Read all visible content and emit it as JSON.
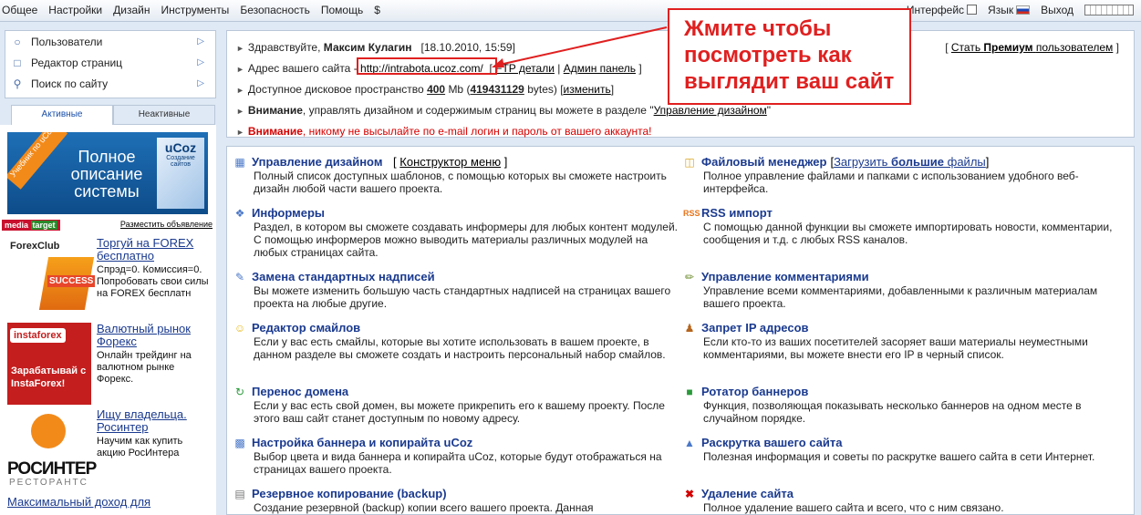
{
  "topbar": {
    "menu": [
      "Общее",
      "Настройки",
      "Дизайн",
      "Инструменты",
      "Безопасность",
      "Помощь",
      "$"
    ],
    "interface_label": "Интерфейс",
    "language_label": "Язык",
    "logout_label": "Выход"
  },
  "leftnav": {
    "items": [
      {
        "label": "Пользователи",
        "icon": "user-icon"
      },
      {
        "label": "Редактор страниц",
        "icon": "page-icon"
      },
      {
        "label": "Поиск по сайту",
        "icon": "search-icon"
      }
    ]
  },
  "tabs": {
    "active": "Активные",
    "inactive": "Неактивные"
  },
  "sidebar": {
    "ucoz_banner": {
      "ribbon": "Учебник по uCoz",
      "text": "Полное описание системы",
      "box_title": "uCoz",
      "box_sub": "Создание сайтов"
    },
    "media_target": {
      "logo_left": "media",
      "logo_right": "target",
      "place_ad": "Разместить объявление"
    },
    "ads": [
      {
        "title": "Торгуй на FOREX бесплатно",
        "desc": "Спрэд=0. Комиссия=0. Попробовать свои силы на FOREX бесплатн",
        "logo": "ForexClub",
        "badge": "SUCCESS"
      },
      {
        "title": "Валютный рынок Форекс",
        "desc": "Онлайн трейдинг на валютном рынке Форекс.",
        "logo": "instaforex",
        "image_text": "Зарабатывай с InstaForex!"
      },
      {
        "title": "Ищу владельца. Росинтер",
        "desc": "Научим как купить акцию РосИнтера",
        "logo": "РОСИНТЕР",
        "logo_sub": "РЕСТОРАНТС"
      }
    ],
    "bottom_link": "Максимальный доход для"
  },
  "info": {
    "greeting_prefix": "Здравствуйте,",
    "user_name": "Максим Кулагин",
    "datetime": "[18.10.2010, 15:59]",
    "premium_prefix": "[",
    "premium_link_1": "Стать",
    "premium_link_bold": "Премиум",
    "premium_link_2": "пользователем",
    "premium_suffix": "]",
    "address_label": "Адрес вашего сайта -",
    "site_url": "http://intrabota.ucoz.com/",
    "ftp_link": "FTP детали",
    "admin_link": "Админ панель",
    "disk_label": "Доступное дисковое пространство",
    "disk_mb": "400",
    "disk_mb_unit": "Mb (",
    "disk_bytes": "419431129",
    "disk_bytes_unit": "bytes)",
    "disk_change": "изменить",
    "note1_bold": "Внимание",
    "note1_text": ", управлять дизайном и содержимым страниц вы можете в разделе \"",
    "note1_link": "Управление дизайном",
    "note1_end": "\"",
    "note2_bold": "Внимание",
    "note2_text": ", никому не высылайте по e-mail логин и пароль от вашего аккаунта!"
  },
  "callout": {
    "line1": "Жмите чтобы",
    "line2": "посмотреть как",
    "line3": "выглядит ваш сайт"
  },
  "modules": [
    {
      "title": "Управление дизайном",
      "sub": "Конструктор меню",
      "desc": "Полный список доступных шаблонов, с помощью которых вы сможете настроить дизайн любой части вашего проекта.",
      "icon": "design-icon"
    },
    {
      "title": "Файловый менеджер",
      "sub_pre": "Загрузить ",
      "sub_bold": "большие",
      "sub_post": " файлы",
      "desc": "Полное управление файлами и папками с использованием удобного веб-интерфейса.",
      "icon": "folder-icon"
    },
    {
      "title": "Информеры",
      "desc": "Раздел, в котором вы сможете создавать информеры для любых контент модулей. С помощью информеров можно выводить материалы различных модулей на любых страницах сайта.",
      "icon": "informer-icon"
    },
    {
      "title": "RSS импорт",
      "desc": "С помощью данной функции вы сможете импортировать новости, комментарии, сообщения и т.д. с любых RSS каналов.",
      "icon": "rss-icon"
    },
    {
      "title": "Замена стандартных надписей",
      "desc": "Вы можете изменить большую часть стандартных надписей на страницах вашего проекта на любые другие.",
      "icon": "labels-icon"
    },
    {
      "title": "Управление комментариями",
      "desc": "Управление всеми комментариями, добавленными к различным материалам вашего проекта.",
      "icon": "comments-icon"
    },
    {
      "title": "Редактор смайлов",
      "desc": "Если у вас есть смайлы, которые вы хотите использовать в вашем проекте, в данном разделе вы сможете создать и настроить персональный набор смайлов.",
      "icon": "smiley-icon"
    },
    {
      "title": "Запрет IP адресов",
      "desc": "Если кто-то из ваших посетителей засоряет ваши материалы неуместными комментариями, вы можете внести его IP в черный список.",
      "icon": "ban-users-icon"
    },
    {
      "title": "Перенос домена",
      "desc": "Если у вас есть свой домен, вы можете прикрепить его к вашему проекту. После этого ваш сайт станет доступным по новому адресу.",
      "icon": "domain-icon"
    },
    {
      "title": "Ротатор баннеров",
      "desc": "Функция, позволяющая показывать несколько баннеров на одном месте в случайном порядке.",
      "icon": "banner-rotator-icon"
    },
    {
      "title": "Настройка баннера и копирайта uCoz",
      "desc": "Выбор цвета и вида баннера и копирайта uCoz, которые будут отображаться на страницах вашего проекта.",
      "icon": "banner-settings-icon"
    },
    {
      "title": "Раскрутка вашего сайта",
      "desc": "Полезная информация и советы по раскрутке вашего сайта в сети Интернет.",
      "icon": "promo-icon"
    },
    {
      "title": "Резервное копирование (backup)",
      "desc": "Создание резервной (backup) копии всего вашего проекта. Данная",
      "icon": "backup-icon"
    },
    {
      "title": "Удаление сайта",
      "desc": "Полное удаление вашего сайта и всего, что с ним связано.",
      "icon": "delete-icon"
    }
  ],
  "colors": {
    "accent": "#1a3a8f",
    "warning": "#d40000",
    "callout": "#e02020",
    "frame": "#b9c7d8"
  }
}
